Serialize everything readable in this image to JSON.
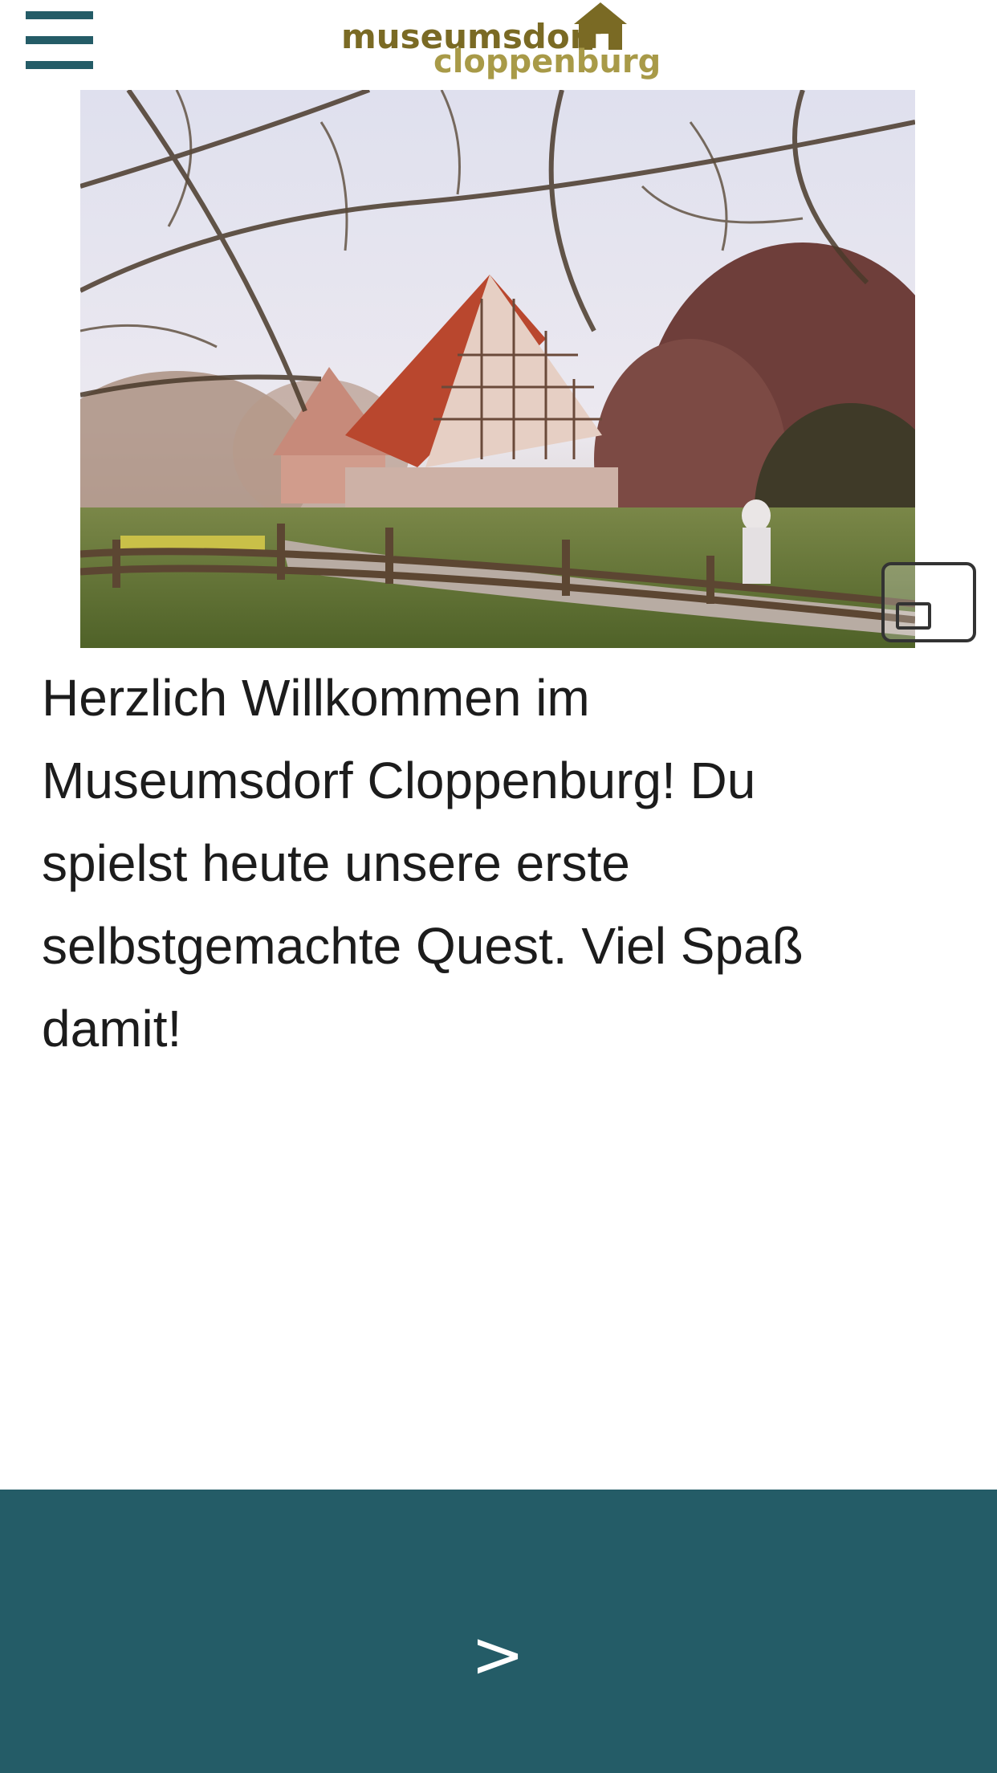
{
  "header": {
    "menu_icon": "hamburger-menu-icon",
    "logo": {
      "line1": "museumsdorf",
      "line2": "cloppenburg",
      "color_dark": "#7a6a24",
      "color_light": "#a89a48"
    }
  },
  "hero": {
    "fullscreen_icon": "picture-in-picture-icon"
  },
  "content": {
    "intro_text": "Herzlich Willkommen im Museumsdorf Cloppenburg! Du spielst heute unsere erste selbstgemachte Quest. Viel Spaß damit!"
  },
  "footer": {
    "next_label": ">",
    "background": "#245c67"
  }
}
